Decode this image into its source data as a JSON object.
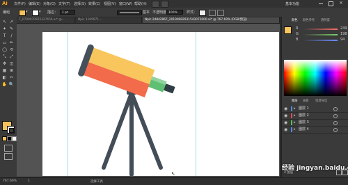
{
  "app": {
    "logo": "Ai"
  },
  "menu": {
    "items": [
      "文件(F)",
      "编辑(E)",
      "对象(O)",
      "文字(T)",
      "选择(S)",
      "效果(C)",
      "视图(V)",
      "窗口(W)",
      "帮助(H)"
    ],
    "workspace": "基本功能"
  },
  "control": {
    "group_label": "编组",
    "stroke_label": "描边：",
    "stroke_width": "1 pt",
    "style_label": "基本",
    "opacity_label": "不透明度：",
    "opacity_value": "100%",
    "style_field": "样式：",
    "fill_color": "#f5c35a"
  },
  "tabs": [
    {
      "label": "7_0709070925327656.ai* @..."
    },
    {
      "label": "Npic 1109071..."
    },
    {
      "label": "Npic 24842867_20190082931543072000.ai* @ 767.69% (RGB/预览)",
      "active": true
    }
  ],
  "toolbox": {
    "tools": [
      "↖",
      "↗",
      "✦",
      "✎",
      "T",
      "/",
      "▭",
      "✏",
      "◯",
      "⟲",
      "⤡",
      "⤢",
      "✥",
      "◫",
      "▦",
      "⊞",
      "◧",
      "✂",
      "✋",
      "🔍"
    ],
    "fill_color": "#f5c35a",
    "stroke_color": "#ffffff"
  },
  "illustration": {
    "tube_orange": "#f26b4a",
    "tube_yellow": "#f9c65e",
    "eyepiece_green": "#5fbf73",
    "eyepiece_dark": "#2f3d45",
    "cap": "#46505a",
    "legs": "#434d57"
  },
  "panels": {
    "tabs": [
      "颜色",
      "颜色参考",
      "透明度"
    ],
    "color": {
      "swatch": "#f9c65e",
      "channels": [
        {
          "label": "R",
          "value": "249",
          "track": "#ff6b6b"
        },
        {
          "label": "G",
          "value": "198",
          "track": "#7dcf6b"
        },
        {
          "label": "B",
          "value": "94",
          "track": "#6b8cff"
        }
      ]
    },
    "layer_tabs": [
      "图层",
      "画板",
      "资源导出"
    ],
    "layers": [
      {
        "name": "图层 1",
        "color": "#4f8fe0",
        "selected": false
      },
      {
        "name": "图层 2",
        "color": "#e04f4f",
        "selected": false
      },
      {
        "name": "图层 3",
        "color": "#4fc04f",
        "selected": false
      },
      {
        "name": "图层 4",
        "color": "#4f8fe0",
        "selected": false
      }
    ],
    "layers_count": "4 图层"
  },
  "status": {
    "zoom": "767.69%",
    "page": "1",
    "tool_label": "选择工具",
    "watermark": "经验 jingyan.baidu.com"
  }
}
